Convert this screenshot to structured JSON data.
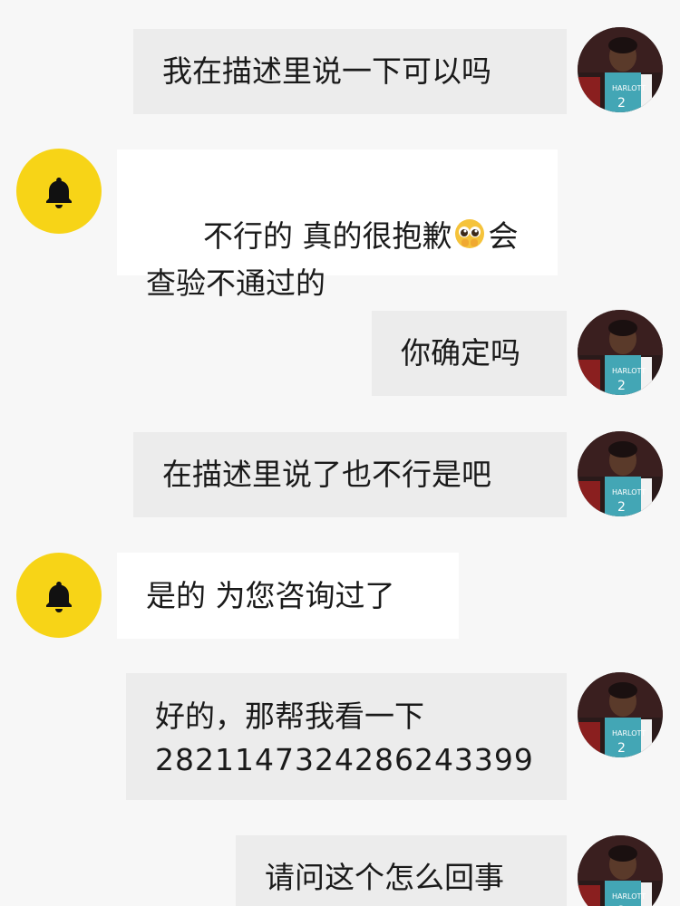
{
  "messages": [
    {
      "sender": "user",
      "text": "我在描述里说一下可以吗"
    },
    {
      "sender": "bot",
      "text_before_emoji": "不行的 真的很抱歉",
      "emoji": "pleading-face",
      "text_after_emoji": "会查验不通过的"
    },
    {
      "sender": "user",
      "text": "你确定吗"
    },
    {
      "sender": "user",
      "text": "在描述里说了也不行是吧"
    },
    {
      "sender": "bot",
      "text": "是的 为您咨询过了"
    },
    {
      "sender": "user",
      "line1": "好的，那帮我看一下",
      "line2": "2821147324286243399"
    },
    {
      "sender": "user",
      "text": "请问这个怎么回事"
    }
  ],
  "icons": {
    "bot_avatar": "bell-icon",
    "user_avatar": "user-photo-avatar"
  },
  "colors": {
    "bot_avatar_bg": "#f7d417",
    "user_bubble": "#ececec",
    "bot_bubble": "#ffffff",
    "page_bg": "#f7f7f7"
  }
}
